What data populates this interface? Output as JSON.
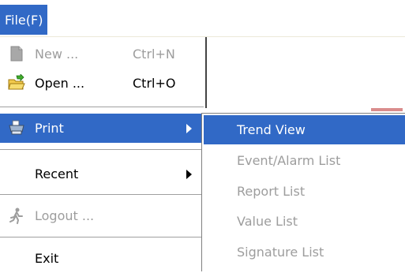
{
  "menubar": {
    "title": "File(F)"
  },
  "file_menu": {
    "items": [
      {
        "label": "New ...",
        "shortcut": "Ctrl+N",
        "icon": "new-document-icon",
        "enabled": false
      },
      {
        "label": "Open ...",
        "shortcut": "Ctrl+O",
        "icon": "open-folder-icon",
        "enabled": true
      },
      {
        "label": "Print",
        "icon": "printer-icon",
        "enabled": true,
        "has_submenu": true,
        "highlighted": true
      },
      {
        "label": "Recent",
        "enabled": true,
        "has_submenu": true
      },
      {
        "label": "Logout ...",
        "icon": "logout-icon",
        "enabled": false
      },
      {
        "label": "Exit",
        "enabled": true
      }
    ]
  },
  "print_submenu": {
    "items": [
      {
        "label": "Trend View",
        "enabled": true,
        "highlighted": true
      },
      {
        "label": "Event/Alarm List",
        "enabled": false
      },
      {
        "label": "Report List",
        "enabled": false
      },
      {
        "label": "Value List",
        "enabled": false
      },
      {
        "label": "Signature List",
        "enabled": false
      }
    ]
  },
  "colors": {
    "highlight": "#3169c6",
    "disabled_text": "#9d9d9d",
    "text": "#000000",
    "background": "#ffffff"
  }
}
